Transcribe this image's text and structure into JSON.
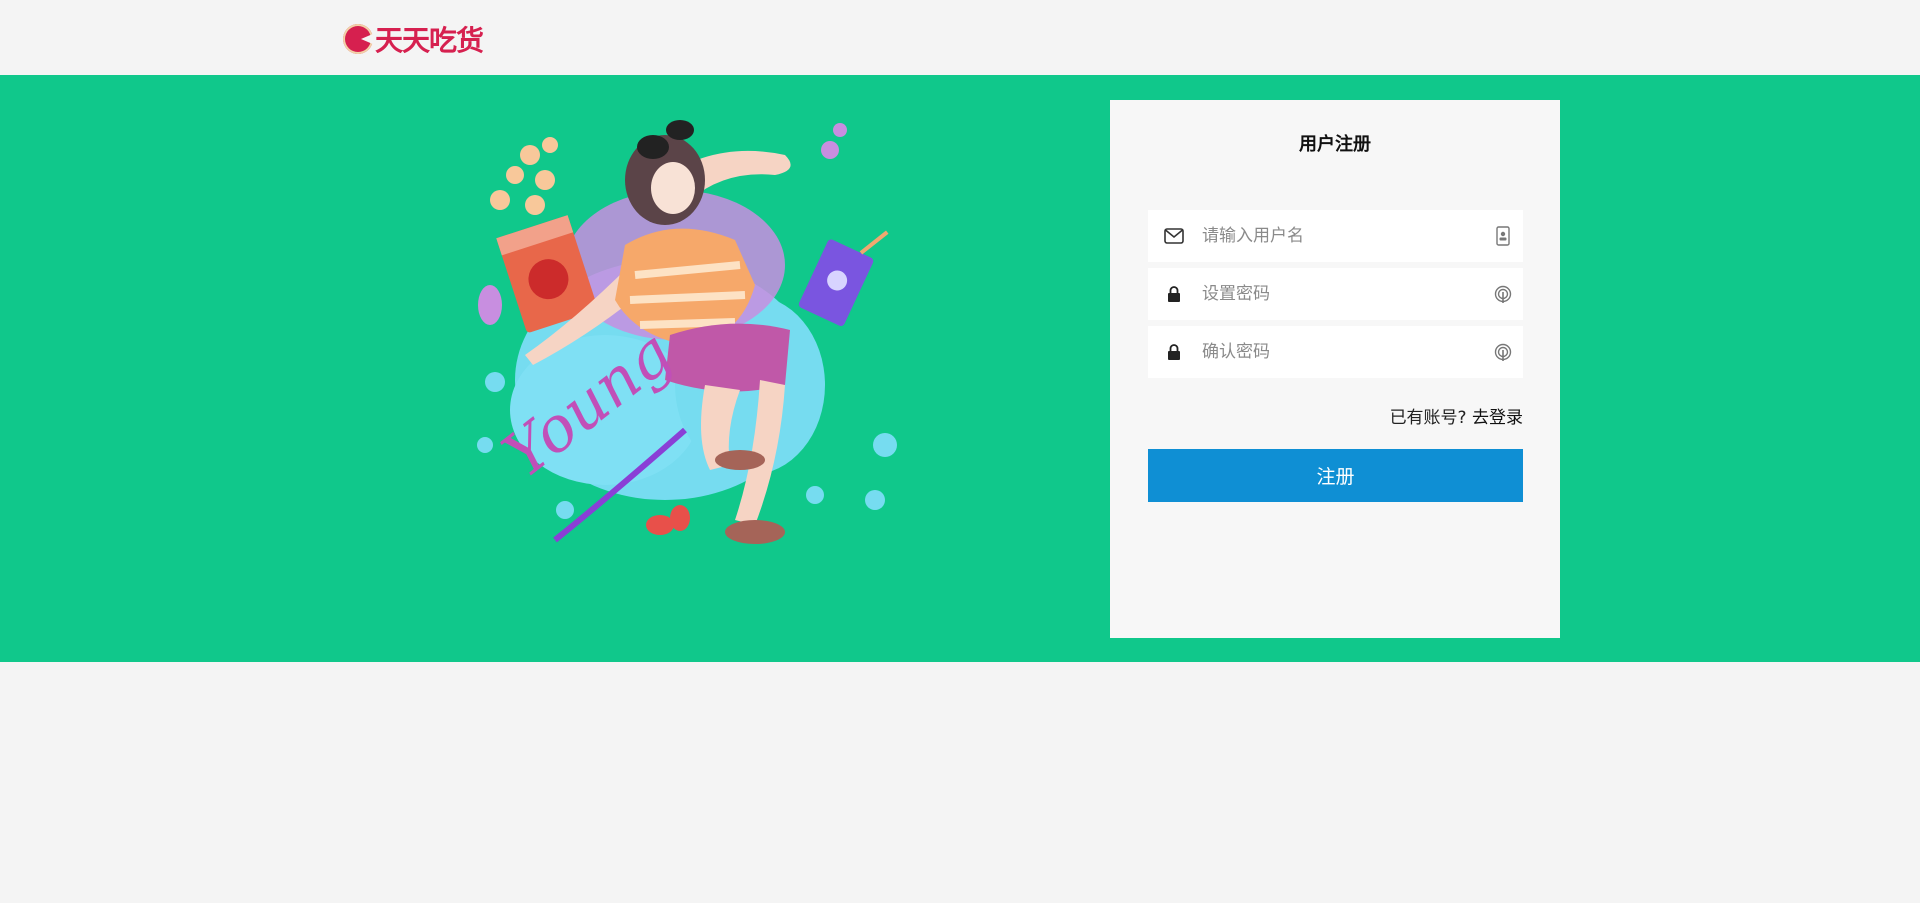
{
  "header": {
    "logo_text": "天天吃货",
    "brand_color": "#d6204f"
  },
  "banner": {
    "background_color": "#10c88b",
    "illustration_icon": "girl-with-snacks-illustration",
    "illustration_text": "Young"
  },
  "register_form": {
    "title": "用户注册",
    "username": {
      "placeholder": "请输入用户名",
      "value": "",
      "lead_icon": "envelope-icon",
      "trail_icon": "contact-card-icon"
    },
    "password": {
      "placeholder": "设置密码",
      "value": "",
      "lead_icon": "lock-icon",
      "trail_icon": "fingerprint-icon"
    },
    "confirm_password": {
      "placeholder": "确认密码",
      "value": "",
      "lead_icon": "lock-icon",
      "trail_icon": "fingerprint-icon"
    },
    "has_account_text": "已有账号?",
    "login_link": "去登录",
    "submit_label": "注册",
    "submit_color": "#0f8fd4"
  }
}
